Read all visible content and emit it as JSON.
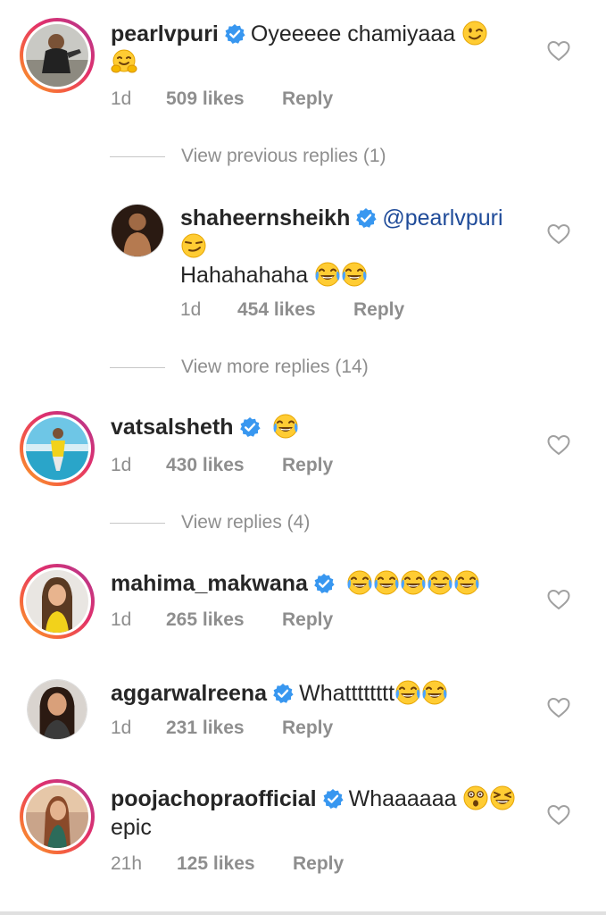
{
  "comments": [
    {
      "username": "pearlvpuri",
      "verified": true,
      "text": "Oyeeeee chamiyaaa",
      "emojis": [
        "winking-face-emoji",
        "hugging-face-emoji"
      ],
      "age": "1d",
      "likes": "509 likes",
      "reply": "Reply",
      "avatar": "avatar-pearlvpuri",
      "story_ring": true
    },
    {
      "username": "shaheernsheikh",
      "verified": true,
      "mention": "@pearlvpuri",
      "text": "Hahahahaha",
      "emojis": [
        "smirking-face-emoji",
        "tears-of-joy-emoji",
        "tears-of-joy-emoji"
      ],
      "age": "1d",
      "likes": "454 likes",
      "reply": "Reply",
      "avatar": "avatar-shaheernsheikh",
      "story_ring": false
    },
    {
      "username": "vatsalsheth",
      "verified": true,
      "text": "",
      "emojis": [
        "tears-of-joy-emoji"
      ],
      "age": "1d",
      "likes": "430 likes",
      "reply": "Reply",
      "avatar": "avatar-vatsalsheth",
      "story_ring": true
    },
    {
      "username": "mahima_makwana",
      "verified": true,
      "text": "",
      "emojis": [
        "tears-of-joy-emoji",
        "tears-of-joy-emoji",
        "tears-of-joy-emoji",
        "tears-of-joy-emoji",
        "tears-of-joy-emoji"
      ],
      "age": "1d",
      "likes": "265 likes",
      "reply": "Reply",
      "avatar": "avatar-mahima_makwana",
      "story_ring": true
    },
    {
      "username": "aggarwalreena",
      "verified": true,
      "text": "Whatttttttt",
      "emojis": [
        "tears-of-joy-emoji",
        "tears-of-joy-emoji"
      ],
      "age": "1d",
      "likes": "231 likes",
      "reply": "Reply",
      "avatar": "avatar-aggarwalreena",
      "story_ring": false
    },
    {
      "username": "poojachopraofficial",
      "verified": true,
      "text": "Whaaaaaa",
      "text2": "epic",
      "emojis": [
        "astonished-face-emoji",
        "grinning-squinting-face-emoji"
      ],
      "age": "21h",
      "likes": "125 likes",
      "reply": "Reply",
      "avatar": "avatar-poojachopraofficial",
      "story_ring": true
    }
  ],
  "thread_links": {
    "previous": "View previous replies (1)",
    "more": "View more replies (14)",
    "replies": "View replies (4)"
  },
  "colors": {
    "text": "#262626",
    "meta": "#8e8e8e",
    "verified": "#3897f0",
    "mention": "#1f4b99",
    "story_ring_start": "#f9a825",
    "story_ring_end": "#c13584"
  },
  "icons": {
    "like": "heart-outline-icon",
    "verified": "verified-badge-icon"
  }
}
